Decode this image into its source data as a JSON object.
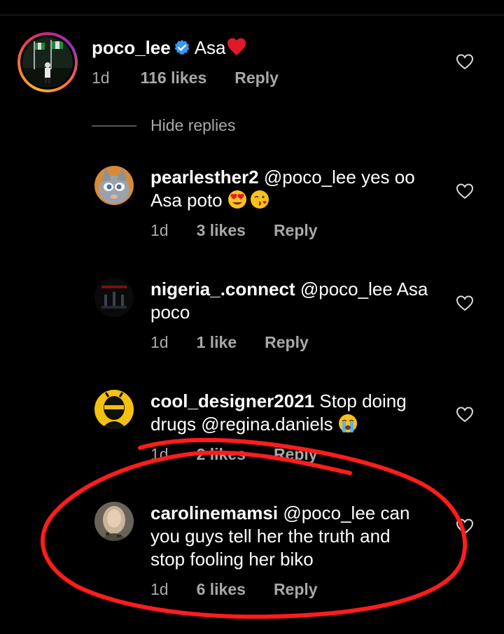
{
  "comments": [
    {
      "username": "poco_lee",
      "verified": true,
      "text": "Asa",
      "emoji": "red-heart",
      "time": "1d",
      "likes": "116 likes",
      "reply": "Reply"
    },
    {
      "username": "pearlesther2",
      "mention": "@poco_lee",
      "text": "yes oo",
      "text2": "Asa poto",
      "emojis": [
        "heart-eyes",
        "face-blowing-kiss"
      ],
      "time": "1d",
      "likes": "3 likes",
      "reply": "Reply"
    },
    {
      "username": "nigeria_.connect",
      "mention": "@poco_lee",
      "text": "Asa",
      "text2": "poco",
      "time": "1d",
      "likes": "1 like",
      "reply": "Reply"
    },
    {
      "username": "cool_designer2021",
      "text": "Stop doing",
      "text2": "drugs",
      "mention2": "@regina.daniels",
      "emoji": "loudly-crying-face",
      "time": "1d",
      "likes": "2 likes",
      "reply": "Reply"
    },
    {
      "username": "carolinemamsi",
      "mention": "@poco_lee",
      "text": "can",
      "text2": "you guys tell her the truth and",
      "text3": "stop fooling her biko",
      "time": "1d",
      "likes": "6 likes",
      "reply": "Reply"
    }
  ],
  "hide_replies": "Hide replies",
  "colors": {
    "background": "#000000",
    "text": "#ffffff",
    "meta": "#a8a8a8",
    "verified": "#3897f0",
    "annotation": "#ff1c1c"
  }
}
